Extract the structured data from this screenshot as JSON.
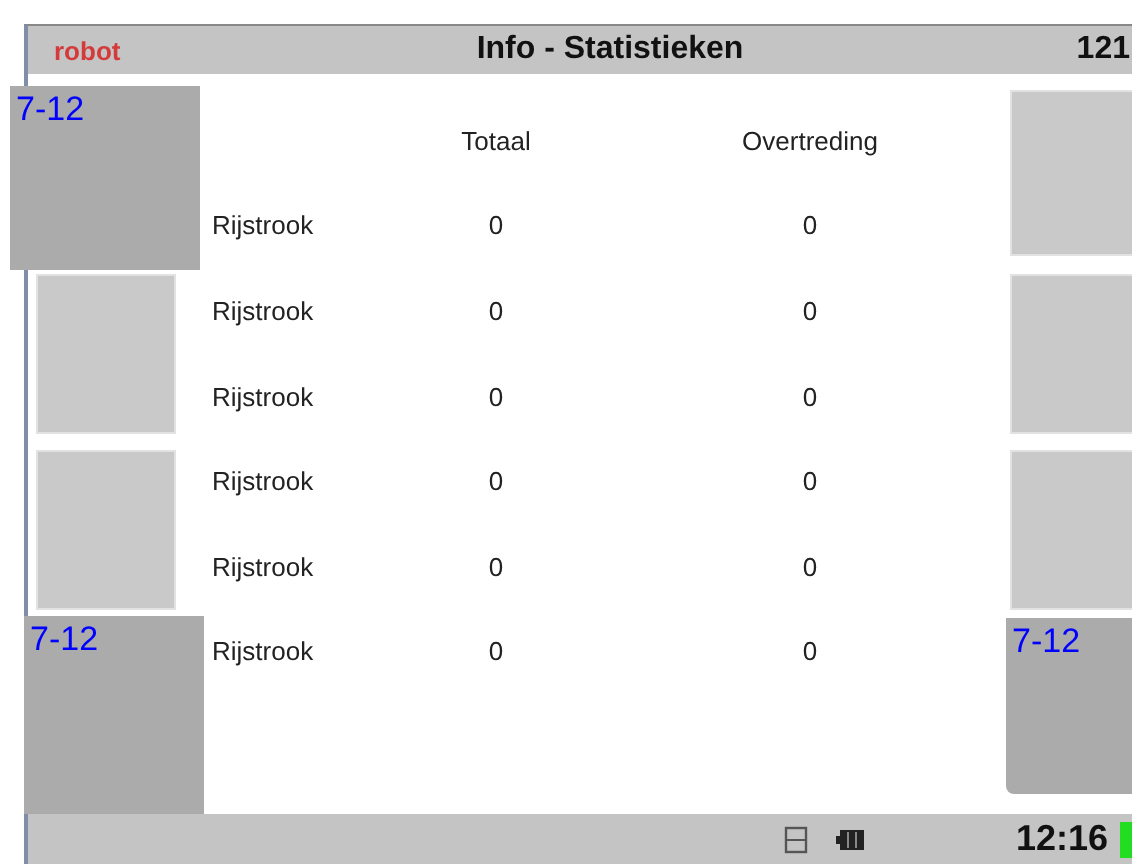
{
  "header": {
    "logo": "robot",
    "title": "Info - Statistieken",
    "number": "121"
  },
  "left_buttons": [
    {
      "kind": "dark",
      "label": "7-12"
    },
    {
      "kind": "light"
    },
    {
      "kind": "light"
    },
    {
      "kind": "dark",
      "label": "7-12"
    }
  ],
  "right_buttons": [
    {
      "kind": "light"
    },
    {
      "kind": "light"
    },
    {
      "kind": "light"
    },
    {
      "kind": "dark",
      "label": "7-12"
    }
  ],
  "table": {
    "columns": [
      "Totaal",
      "Overtreding"
    ],
    "rows": [
      {
        "label": "Rijstrook",
        "total": "0",
        "violation": "0"
      },
      {
        "label": "Rijstrook",
        "total": "0",
        "violation": "0"
      },
      {
        "label": "Rijstrook",
        "total": "0",
        "violation": "0"
      },
      {
        "label": "Rijstrook",
        "total": "0",
        "violation": "0"
      },
      {
        "label": "Rijstrook",
        "total": "0",
        "violation": "0"
      },
      {
        "label": "Rijstrook",
        "total": "0",
        "violation": "0"
      }
    ]
  },
  "status_bar": {
    "time": "12:16"
  }
}
